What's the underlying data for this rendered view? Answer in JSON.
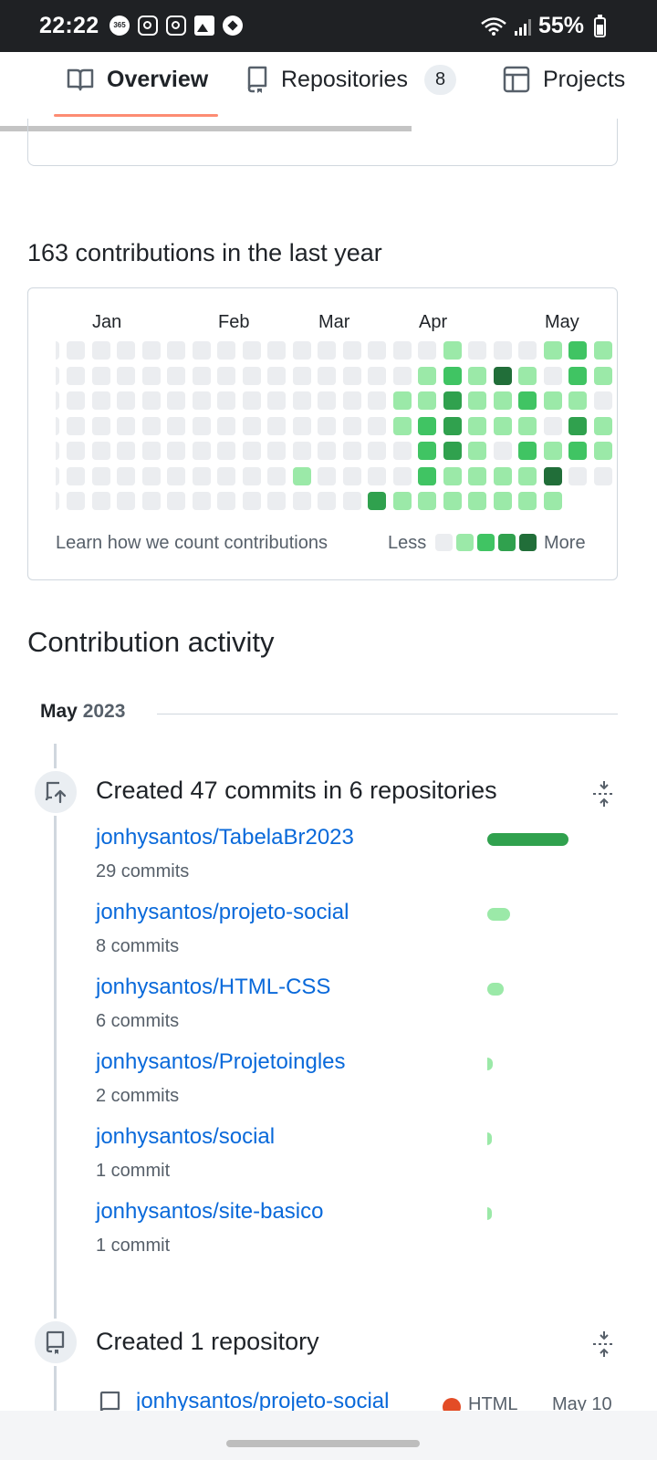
{
  "status_bar": {
    "time": "22:22",
    "notification_icons": [
      "365-icon",
      "instagram-icon",
      "instagram-icon",
      "gallery-icon",
      "football-icon"
    ],
    "battery": "55%"
  },
  "tabs": [
    {
      "label": "Overview",
      "icon": "book-icon",
      "active": true
    },
    {
      "label": "Repositories",
      "icon": "repo-icon",
      "count": "8"
    },
    {
      "label": "Projects",
      "icon": "table-icon"
    }
  ],
  "contributions": {
    "title": "163 contributions in the last year",
    "months": [
      "Jan",
      "Feb",
      "Mar",
      "Apr",
      "May"
    ],
    "levels": [
      [
        0,
        0,
        0,
        0,
        0,
        0,
        0,
        0,
        0,
        0,
        0,
        0,
        0,
        0,
        0,
        1,
        0,
        0,
        0,
        1,
        2,
        1
      ],
      [
        0,
        0,
        0,
        0,
        0,
        0,
        0,
        0,
        0,
        0,
        0,
        0,
        0,
        0,
        1,
        2,
        1,
        4,
        1,
        0,
        2,
        1
      ],
      [
        0,
        0,
        0,
        0,
        0,
        0,
        0,
        0,
        0,
        0,
        0,
        0,
        0,
        1,
        1,
        3,
        1,
        1,
        2,
        1,
        1,
        0
      ],
      [
        0,
        0,
        0,
        0,
        0,
        0,
        0,
        0,
        0,
        0,
        0,
        0,
        0,
        1,
        2,
        3,
        1,
        1,
        1,
        0,
        3,
        1
      ],
      [
        0,
        0,
        0,
        0,
        0,
        0,
        0,
        0,
        0,
        0,
        0,
        0,
        0,
        0,
        2,
        3,
        1,
        0,
        2,
        1,
        2,
        1
      ],
      [
        0,
        0,
        0,
        0,
        0,
        0,
        0,
        0,
        0,
        1,
        0,
        0,
        0,
        0,
        2,
        1,
        1,
        1,
        1,
        4,
        0,
        0
      ],
      [
        0,
        0,
        0,
        0,
        0,
        0,
        0,
        0,
        0,
        0,
        0,
        0,
        3,
        1,
        1,
        1,
        1,
        1,
        1,
        1,
        null,
        null
      ]
    ],
    "palette": [
      "#ebedf0",
      "#9be9a8",
      "#40c463",
      "#30a14e",
      "#216e39"
    ],
    "learn_link": "Learn how we count contributions",
    "legend_less": "Less",
    "legend_more": "More"
  },
  "activity": {
    "title": "Contribution activity",
    "month": "May",
    "year": "2023",
    "commits_event": {
      "title": "Created 47 commits in 6 repositories",
      "icon": "repo-push-icon",
      "fold_icon": "fold-icon",
      "repos": [
        {
          "name": "jonhysantos/TabelaBr2023",
          "commits": "29 commits",
          "commit_count": 29,
          "bar_color": "#30a14e"
        },
        {
          "name": "jonhysantos/projeto-social",
          "commits": "8 commits",
          "commit_count": 8,
          "bar_color": "#9be9a8"
        },
        {
          "name": "jonhysantos/HTML-CSS",
          "commits": "6 commits",
          "commit_count": 6,
          "bar_color": "#9be9a8"
        },
        {
          "name": "jonhysantos/Projetoingles",
          "commits": "2 commits",
          "commit_count": 2,
          "bar_color": "#9be9a8"
        },
        {
          "name": "jonhysantos/social",
          "commits": "1 commit",
          "commit_count": 1,
          "bar_color": "#9be9a8"
        },
        {
          "name": "jonhysantos/site-basico",
          "commits": "1 commit",
          "commit_count": 1,
          "bar_color": "#9be9a8"
        }
      ]
    },
    "created_event": {
      "title": "Created 1 repository",
      "icon": "repo-icon",
      "fold_icon": "fold-icon",
      "repo": {
        "name": "jonhysantos/projeto-social",
        "language": "HTML",
        "language_color": "#e34c26",
        "date": "May 10"
      }
    }
  }
}
